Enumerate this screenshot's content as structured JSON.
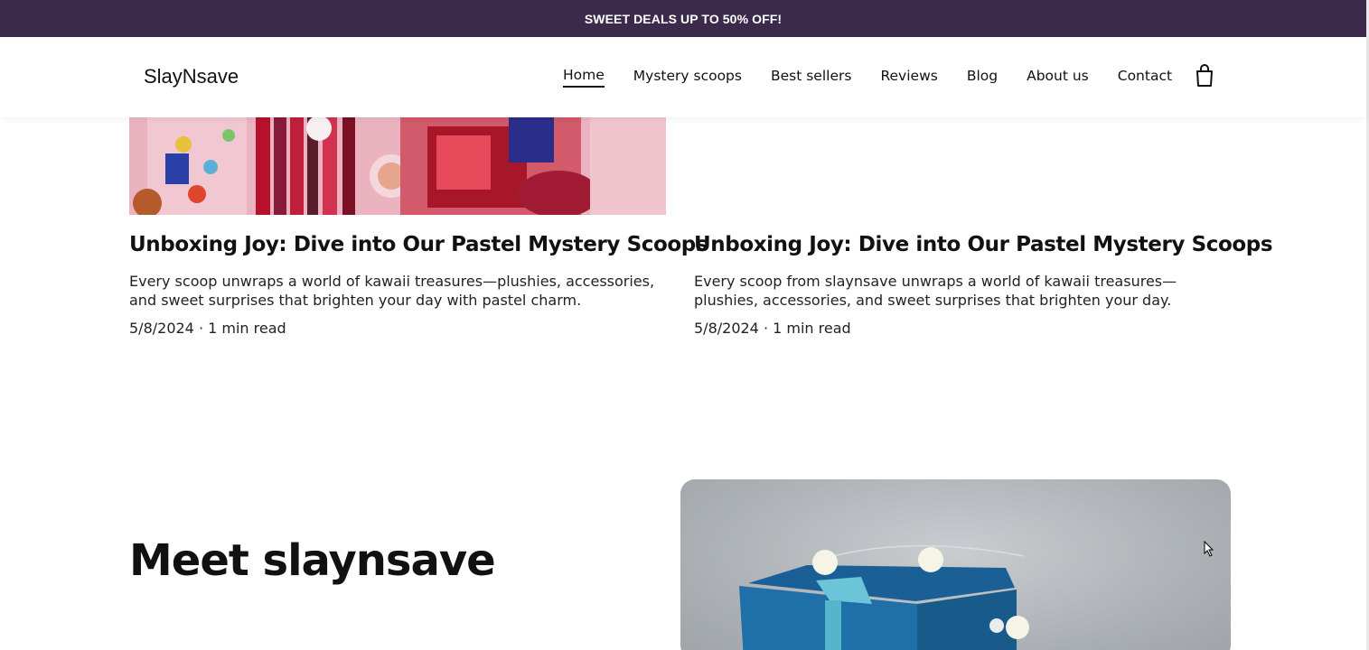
{
  "promo": {
    "text": "SWEET DEALS UP TO 50% OFF!"
  },
  "header": {
    "logo": "SlayNsave",
    "nav": [
      {
        "label": "Home",
        "active": true
      },
      {
        "label": "Mystery scoops"
      },
      {
        "label": "Best sellers"
      },
      {
        "label": "Reviews"
      },
      {
        "label": "Blog"
      },
      {
        "label": "About us"
      },
      {
        "label": "Contact"
      }
    ],
    "cart_icon": "shopping-bag-icon"
  },
  "posts": [
    {
      "title": "Unboxing Joy: Dive into Our Pastel Mystery Scoops",
      "description": "Every scoop unwraps a world of kawaii treasures—plushies, accessories, and sweet surprises that brighten your day with pastel charm.",
      "meta": "5/8/2024 · 1 min read"
    },
    {
      "title": "Unboxing Joy: Dive into Our Pastel Mystery Scoops",
      "description": "Every scoop from slaynsave unwraps a world of kawaii treasures—plushies, accessories, and sweet surprises that brighten your day.",
      "meta": "5/8/2024 · 1 min read"
    }
  ],
  "about": {
    "title": "Meet slaynsave"
  },
  "colors": {
    "promo_bg": "#3c2a4d",
    "gift_box": "#1f6fa8"
  }
}
